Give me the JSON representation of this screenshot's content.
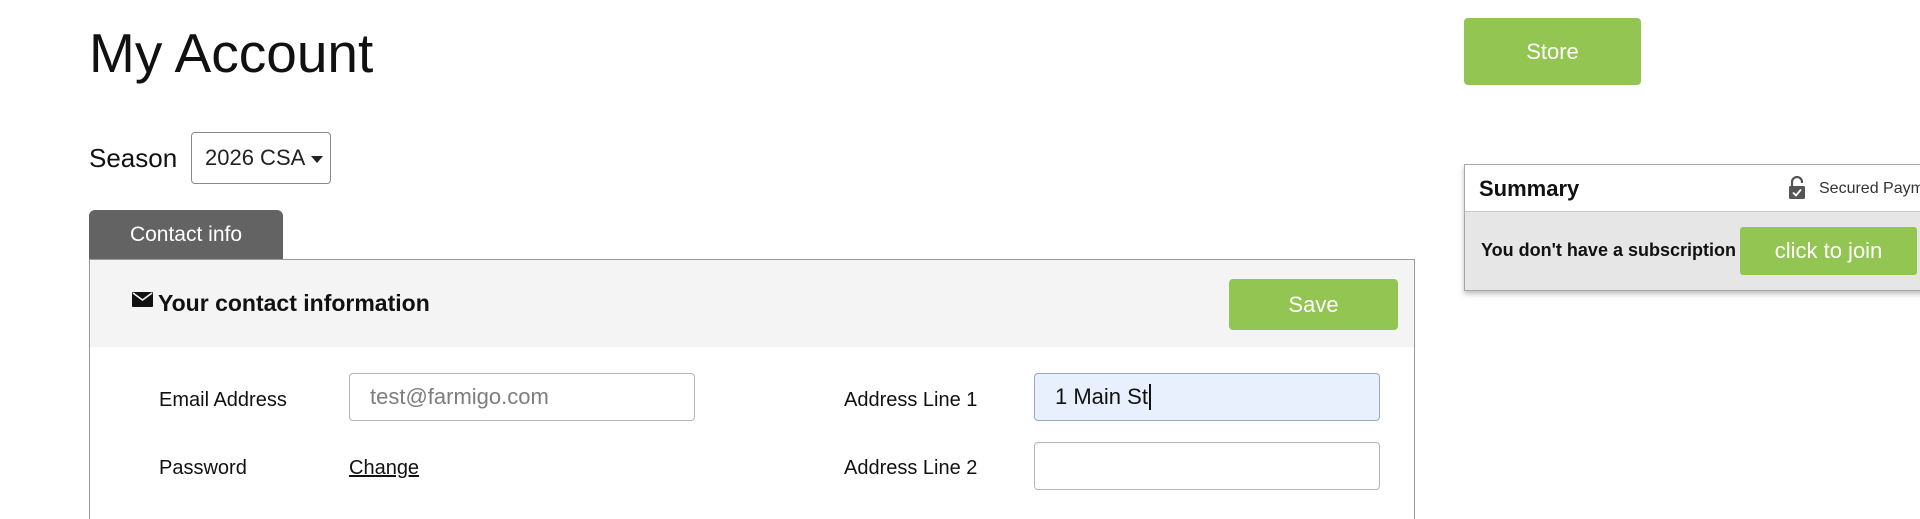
{
  "page": {
    "title": "My Account"
  },
  "season": {
    "label": "Season",
    "selected": "2026 CSA"
  },
  "tabs": [
    {
      "label": "Contact info",
      "active": true
    }
  ],
  "contact_panel": {
    "title": "Your contact information",
    "save_label": "Save",
    "email": {
      "label": "Email Address",
      "placeholder": "test@farmigo.com"
    },
    "password": {
      "label": "Password",
      "change_label": "Change"
    },
    "address1": {
      "label": "Address Line 1",
      "value": "1 Main St"
    },
    "address2": {
      "label": "Address Line 2",
      "value": ""
    }
  },
  "store": {
    "label": "Store"
  },
  "summary": {
    "title": "Summary",
    "secured_text": "Secured Paym",
    "no_subscription_text": "You don't have a subscription",
    "join_label": "click to join"
  },
  "colors": {
    "accent_green": "#93c553",
    "tab_gray": "#636363",
    "focus_blue": "#e8f0fe"
  },
  "icons": {
    "mail": "envelope-icon",
    "lock": "lock-icon",
    "caret": "caret-down-icon"
  }
}
